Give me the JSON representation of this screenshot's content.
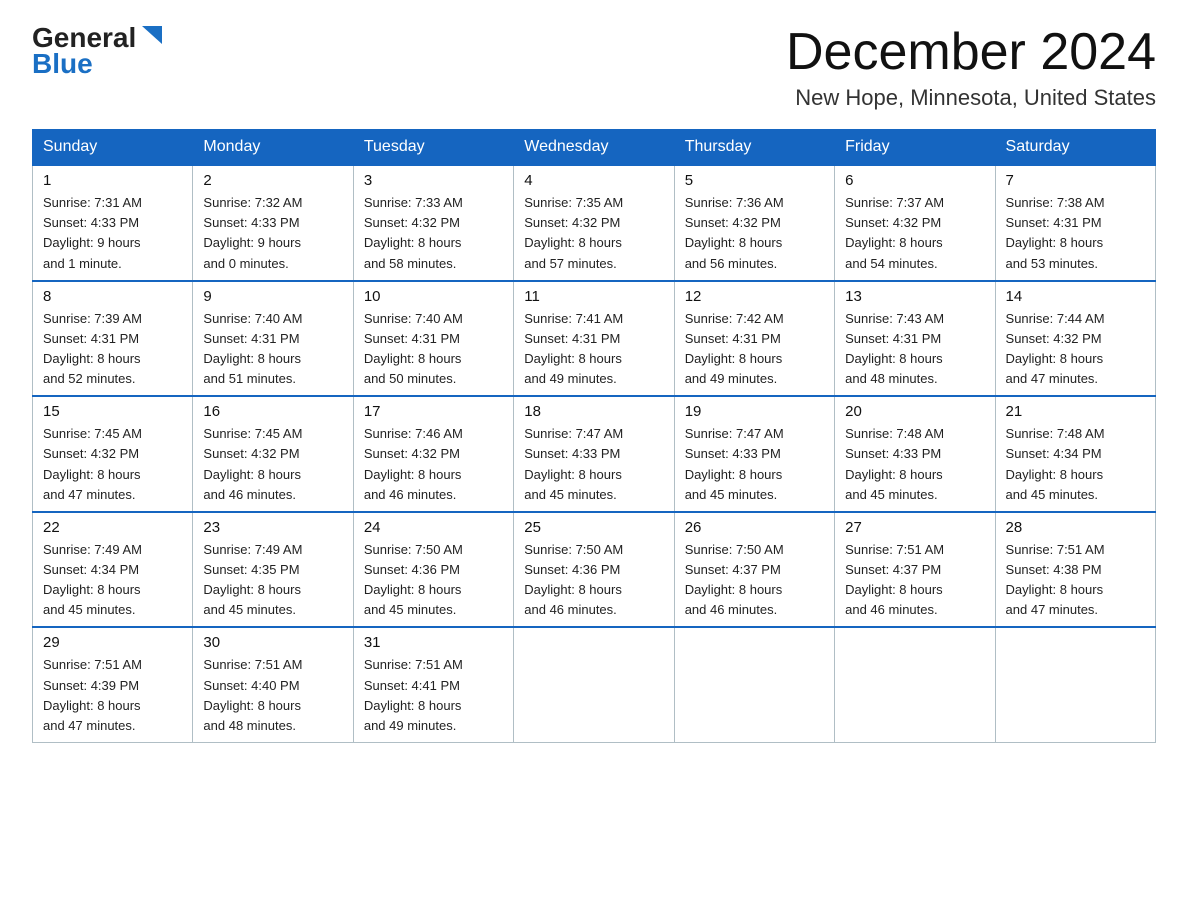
{
  "header": {
    "month_title": "December 2024",
    "location": "New Hope, Minnesota, United States",
    "logo_general": "General",
    "logo_blue": "Blue"
  },
  "days_of_week": [
    "Sunday",
    "Monday",
    "Tuesday",
    "Wednesday",
    "Thursday",
    "Friday",
    "Saturday"
  ],
  "weeks": [
    [
      {
        "day": "1",
        "sunrise": "Sunrise: 7:31 AM",
        "sunset": "Sunset: 4:33 PM",
        "daylight": "Daylight: 9 hours",
        "daylight2": "and 1 minute."
      },
      {
        "day": "2",
        "sunrise": "Sunrise: 7:32 AM",
        "sunset": "Sunset: 4:33 PM",
        "daylight": "Daylight: 9 hours",
        "daylight2": "and 0 minutes."
      },
      {
        "day": "3",
        "sunrise": "Sunrise: 7:33 AM",
        "sunset": "Sunset: 4:32 PM",
        "daylight": "Daylight: 8 hours",
        "daylight2": "and 58 minutes."
      },
      {
        "day": "4",
        "sunrise": "Sunrise: 7:35 AM",
        "sunset": "Sunset: 4:32 PM",
        "daylight": "Daylight: 8 hours",
        "daylight2": "and 57 minutes."
      },
      {
        "day": "5",
        "sunrise": "Sunrise: 7:36 AM",
        "sunset": "Sunset: 4:32 PM",
        "daylight": "Daylight: 8 hours",
        "daylight2": "and 56 minutes."
      },
      {
        "day": "6",
        "sunrise": "Sunrise: 7:37 AM",
        "sunset": "Sunset: 4:32 PM",
        "daylight": "Daylight: 8 hours",
        "daylight2": "and 54 minutes."
      },
      {
        "day": "7",
        "sunrise": "Sunrise: 7:38 AM",
        "sunset": "Sunset: 4:31 PM",
        "daylight": "Daylight: 8 hours",
        "daylight2": "and 53 minutes."
      }
    ],
    [
      {
        "day": "8",
        "sunrise": "Sunrise: 7:39 AM",
        "sunset": "Sunset: 4:31 PM",
        "daylight": "Daylight: 8 hours",
        "daylight2": "and 52 minutes."
      },
      {
        "day": "9",
        "sunrise": "Sunrise: 7:40 AM",
        "sunset": "Sunset: 4:31 PM",
        "daylight": "Daylight: 8 hours",
        "daylight2": "and 51 minutes."
      },
      {
        "day": "10",
        "sunrise": "Sunrise: 7:40 AM",
        "sunset": "Sunset: 4:31 PM",
        "daylight": "Daylight: 8 hours",
        "daylight2": "and 50 minutes."
      },
      {
        "day": "11",
        "sunrise": "Sunrise: 7:41 AM",
        "sunset": "Sunset: 4:31 PM",
        "daylight": "Daylight: 8 hours",
        "daylight2": "and 49 minutes."
      },
      {
        "day": "12",
        "sunrise": "Sunrise: 7:42 AM",
        "sunset": "Sunset: 4:31 PM",
        "daylight": "Daylight: 8 hours",
        "daylight2": "and 49 minutes."
      },
      {
        "day": "13",
        "sunrise": "Sunrise: 7:43 AM",
        "sunset": "Sunset: 4:31 PM",
        "daylight": "Daylight: 8 hours",
        "daylight2": "and 48 minutes."
      },
      {
        "day": "14",
        "sunrise": "Sunrise: 7:44 AM",
        "sunset": "Sunset: 4:32 PM",
        "daylight": "Daylight: 8 hours",
        "daylight2": "and 47 minutes."
      }
    ],
    [
      {
        "day": "15",
        "sunrise": "Sunrise: 7:45 AM",
        "sunset": "Sunset: 4:32 PM",
        "daylight": "Daylight: 8 hours",
        "daylight2": "and 47 minutes."
      },
      {
        "day": "16",
        "sunrise": "Sunrise: 7:45 AM",
        "sunset": "Sunset: 4:32 PM",
        "daylight": "Daylight: 8 hours",
        "daylight2": "and 46 minutes."
      },
      {
        "day": "17",
        "sunrise": "Sunrise: 7:46 AM",
        "sunset": "Sunset: 4:32 PM",
        "daylight": "Daylight: 8 hours",
        "daylight2": "and 46 minutes."
      },
      {
        "day": "18",
        "sunrise": "Sunrise: 7:47 AM",
        "sunset": "Sunset: 4:33 PM",
        "daylight": "Daylight: 8 hours",
        "daylight2": "and 45 minutes."
      },
      {
        "day": "19",
        "sunrise": "Sunrise: 7:47 AM",
        "sunset": "Sunset: 4:33 PM",
        "daylight": "Daylight: 8 hours",
        "daylight2": "and 45 minutes."
      },
      {
        "day": "20",
        "sunrise": "Sunrise: 7:48 AM",
        "sunset": "Sunset: 4:33 PM",
        "daylight": "Daylight: 8 hours",
        "daylight2": "and 45 minutes."
      },
      {
        "day": "21",
        "sunrise": "Sunrise: 7:48 AM",
        "sunset": "Sunset: 4:34 PM",
        "daylight": "Daylight: 8 hours",
        "daylight2": "and 45 minutes."
      }
    ],
    [
      {
        "day": "22",
        "sunrise": "Sunrise: 7:49 AM",
        "sunset": "Sunset: 4:34 PM",
        "daylight": "Daylight: 8 hours",
        "daylight2": "and 45 minutes."
      },
      {
        "day": "23",
        "sunrise": "Sunrise: 7:49 AM",
        "sunset": "Sunset: 4:35 PM",
        "daylight": "Daylight: 8 hours",
        "daylight2": "and 45 minutes."
      },
      {
        "day": "24",
        "sunrise": "Sunrise: 7:50 AM",
        "sunset": "Sunset: 4:36 PM",
        "daylight": "Daylight: 8 hours",
        "daylight2": "and 45 minutes."
      },
      {
        "day": "25",
        "sunrise": "Sunrise: 7:50 AM",
        "sunset": "Sunset: 4:36 PM",
        "daylight": "Daylight: 8 hours",
        "daylight2": "and 46 minutes."
      },
      {
        "day": "26",
        "sunrise": "Sunrise: 7:50 AM",
        "sunset": "Sunset: 4:37 PM",
        "daylight": "Daylight: 8 hours",
        "daylight2": "and 46 minutes."
      },
      {
        "day": "27",
        "sunrise": "Sunrise: 7:51 AM",
        "sunset": "Sunset: 4:37 PM",
        "daylight": "Daylight: 8 hours",
        "daylight2": "and 46 minutes."
      },
      {
        "day": "28",
        "sunrise": "Sunrise: 7:51 AM",
        "sunset": "Sunset: 4:38 PM",
        "daylight": "Daylight: 8 hours",
        "daylight2": "and 47 minutes."
      }
    ],
    [
      {
        "day": "29",
        "sunrise": "Sunrise: 7:51 AM",
        "sunset": "Sunset: 4:39 PM",
        "daylight": "Daylight: 8 hours",
        "daylight2": "and 47 minutes."
      },
      {
        "day": "30",
        "sunrise": "Sunrise: 7:51 AM",
        "sunset": "Sunset: 4:40 PM",
        "daylight": "Daylight: 8 hours",
        "daylight2": "and 48 minutes."
      },
      {
        "day": "31",
        "sunrise": "Sunrise: 7:51 AM",
        "sunset": "Sunset: 4:41 PM",
        "daylight": "Daylight: 8 hours",
        "daylight2": "and 49 minutes."
      },
      null,
      null,
      null,
      null
    ]
  ]
}
